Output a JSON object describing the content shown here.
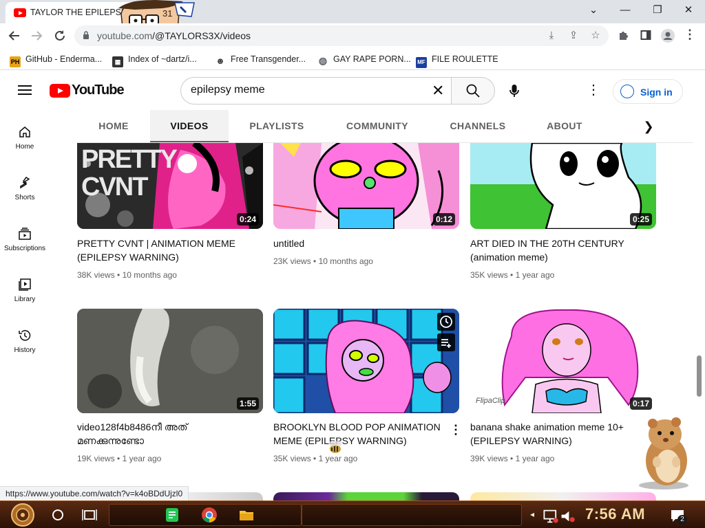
{
  "browser": {
    "tab_title": "TAYLOR THE EPILEPSY",
    "window_controls": {
      "minimize": "⌄",
      "restore": "—",
      "maximize": "❐",
      "close": "✕"
    },
    "url_prefix": "youtube.com",
    "url_path": "/@TAYLORS3X/videos",
    "status_url": "https://www.youtube.com/watch?v=k4oBDdUjzl0",
    "bookmarks": [
      {
        "label": "GitHub - Enderma...",
        "icon": "PH",
        "icon_color": "#e8a317"
      },
      {
        "label": "Index of ~dartz/i...",
        "icon": "image-icon",
        "icon_color": "#333333"
      },
      {
        "label": "Free Transgender...",
        "icon": "mask-icon",
        "icon_color": "#444444"
      },
      {
        "label": "GAY RAPE PORN...",
        "icon": "globe-icon",
        "icon_color": "#5f6368"
      },
      {
        "label": "FILE ROULETTE",
        "icon": "MF",
        "icon_color": "#1a3fa0"
      }
    ]
  },
  "youtube": {
    "logo_text": "YouTube",
    "search_value": "epilepsy meme",
    "signin_label": "Sign in",
    "tabs": [
      "HOME",
      "VIDEOS",
      "PLAYLISTS",
      "COMMUNITY",
      "CHANNELS",
      "ABOUT"
    ],
    "active_tab": "VIDEOS",
    "guide": [
      {
        "label": "Home",
        "icon": "home-icon"
      },
      {
        "label": "Shorts",
        "icon": "shorts-icon"
      },
      {
        "label": "Subscriptions",
        "icon": "subscriptions-icon"
      },
      {
        "label": "Library",
        "icon": "library-icon"
      },
      {
        "label": "History",
        "icon": "history-icon"
      }
    ],
    "videos": [
      {
        "title": "PRETTY CVNT | ANIMATION MEME (EPILEPSY WARNING)",
        "views": "38K views",
        "age": "10 months ago",
        "duration": "0:24",
        "thumb_text": "PRETTY CVNT"
      },
      {
        "title": "untitled",
        "views": "23K views",
        "age": "10 months ago",
        "duration": "0:12"
      },
      {
        "title": "ART DIED IN THE 20TH CENTURY (animation meme)",
        "views": "35K views",
        "age": "1 year ago",
        "duration": "0:25"
      },
      {
        "title": "video128f4b8486നീ അത് മണക്കുന്നുണ്ടോ",
        "views": "19K views",
        "age": "1 year ago",
        "duration": "1:55"
      },
      {
        "title": "BROOKLYN BLOOD POP ANIMATION MEME (EPILEPSY WARNING)",
        "views": "35K views",
        "age": "1 year ago",
        "duration": ""
      },
      {
        "title": "banana shake animation meme 10+ (EPILEPSY WARNING)",
        "views": "39K views",
        "age": "1 year ago",
        "duration": "0:17",
        "watermark": "FlipaClip"
      }
    ],
    "meta_separator": "•"
  },
  "taskbar": {
    "clock": "7:56 AM",
    "notification_count": "2"
  }
}
